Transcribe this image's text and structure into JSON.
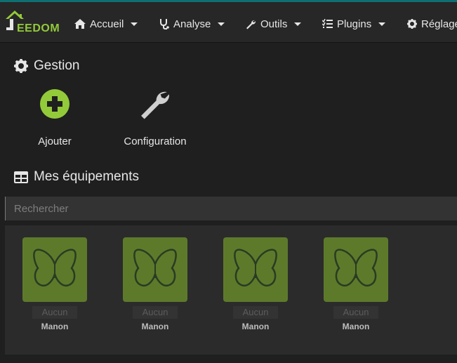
{
  "logo_text": "EEDOM",
  "nav": [
    {
      "label": "Accueil",
      "icon": "home-icon"
    },
    {
      "label": "Analyse",
      "icon": "stethoscope-icon"
    },
    {
      "label": "Outils",
      "icon": "wrench-icon"
    },
    {
      "label": "Plugins",
      "icon": "list-check-icon"
    },
    {
      "label": "Réglage",
      "icon": "gear-icon"
    }
  ],
  "gestion": {
    "title": "Gestion",
    "actions": [
      {
        "label": "Ajouter",
        "icon": "plus-circle-icon"
      },
      {
        "label": "Configuration",
        "icon": "wrench-icon"
      }
    ]
  },
  "equipements": {
    "title": "Mes équipements",
    "search_placeholder": "Rechercher",
    "items": [
      {
        "badge": "Aucun",
        "name": "Manon"
      },
      {
        "badge": "Aucun",
        "name": "Manon"
      },
      {
        "badge": "Aucun",
        "name": "Manon"
      },
      {
        "badge": "Aucun",
        "name": "Manon"
      }
    ]
  },
  "colors": {
    "accent": "#93ca3a",
    "card_bg": "#5d7a2b",
    "topline": "#0e6f72"
  }
}
